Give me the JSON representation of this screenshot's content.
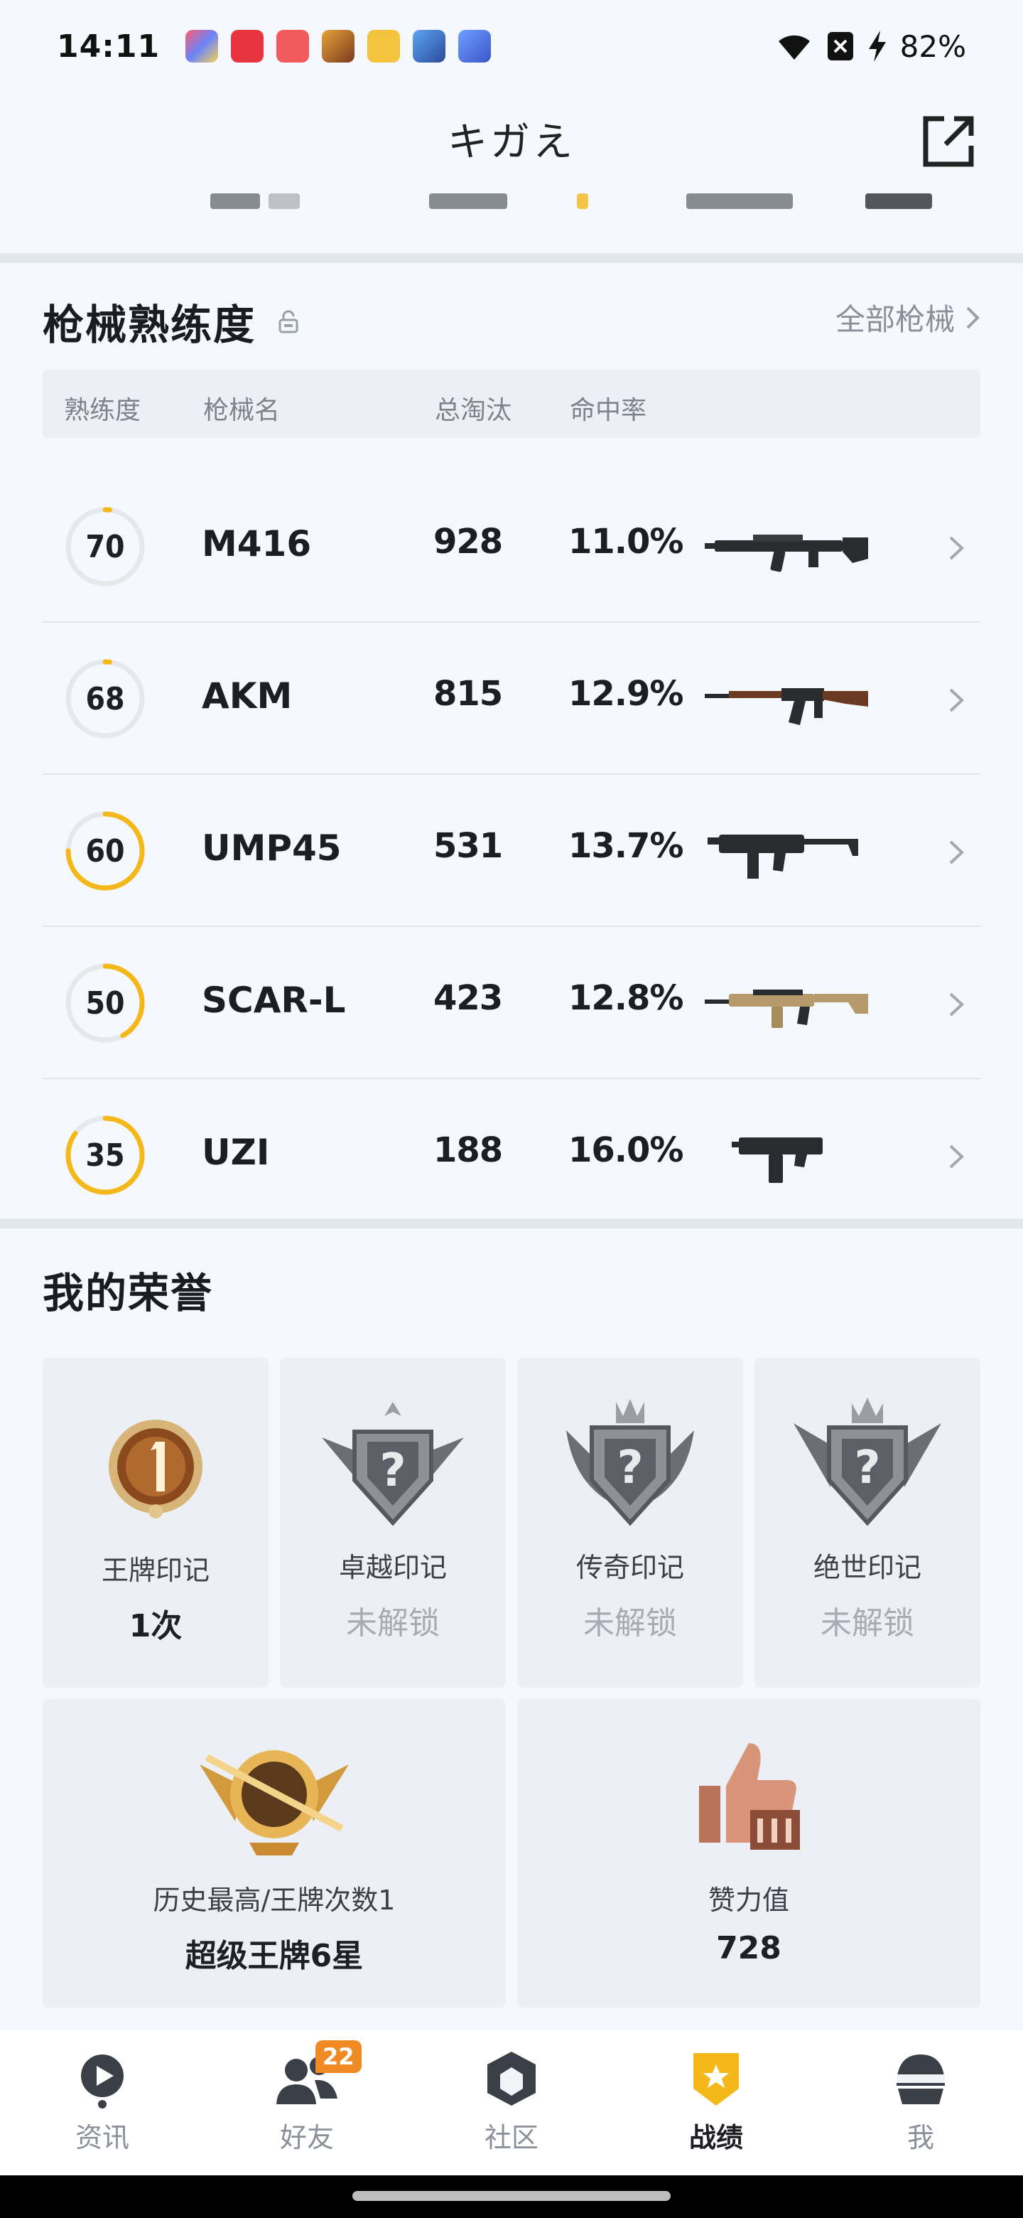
{
  "status_bar": {
    "time": "14:11",
    "battery": "82%"
  },
  "header": {
    "title": "キガえ"
  },
  "weapons_section": {
    "title": "枪械熟练度",
    "all_link": "全部枪械",
    "columns": [
      "熟练度",
      "枪械名",
      "总淘汰",
      "命中率"
    ],
    "rows": [
      {
        "mastery": "70",
        "mastery_pct": 0.02,
        "name": "M416",
        "kills": "928",
        "accuracy": "11.0%"
      },
      {
        "mastery": "68",
        "mastery_pct": 0.02,
        "name": "AKM",
        "kills": "815",
        "accuracy": "12.9%"
      },
      {
        "mastery": "60",
        "mastery_pct": 0.75,
        "name": "UMP45",
        "kills": "531",
        "accuracy": "13.7%"
      },
      {
        "mastery": "50",
        "mastery_pct": 0.42,
        "name": "SCAR-L",
        "kills": "423",
        "accuracy": "12.8%"
      },
      {
        "mastery": "35",
        "mastery_pct": 0.85,
        "name": "UZI",
        "kills": "188",
        "accuracy": "16.0%"
      }
    ]
  },
  "honor_section": {
    "title": "我的荣誉",
    "marks": [
      {
        "label": "王牌印记",
        "value": "1次",
        "locked": false
      },
      {
        "label": "卓越印记",
        "value": "未解锁",
        "locked": true
      },
      {
        "label": "传奇印记",
        "value": "未解锁",
        "locked": true
      },
      {
        "label": "绝世印记",
        "value": "未解锁",
        "locked": true
      }
    ],
    "best": {
      "label": "历史最高/王牌次数1",
      "value": "超级王牌6星"
    },
    "likes": {
      "label": "赞力值",
      "value": "728"
    }
  },
  "bottom_nav": {
    "items": [
      {
        "label": "资讯",
        "icon": "news-icon"
      },
      {
        "label": "好友",
        "icon": "friends-icon",
        "badge": "22"
      },
      {
        "label": "社区",
        "icon": "community-icon"
      },
      {
        "label": "战绩",
        "icon": "record-icon",
        "active": true
      },
      {
        "label": "我",
        "icon": "profile-icon"
      }
    ]
  },
  "colors": {
    "accent": "#f5b81b",
    "ring_track": "#e6e8ec",
    "text_muted": "#8a8f99"
  }
}
